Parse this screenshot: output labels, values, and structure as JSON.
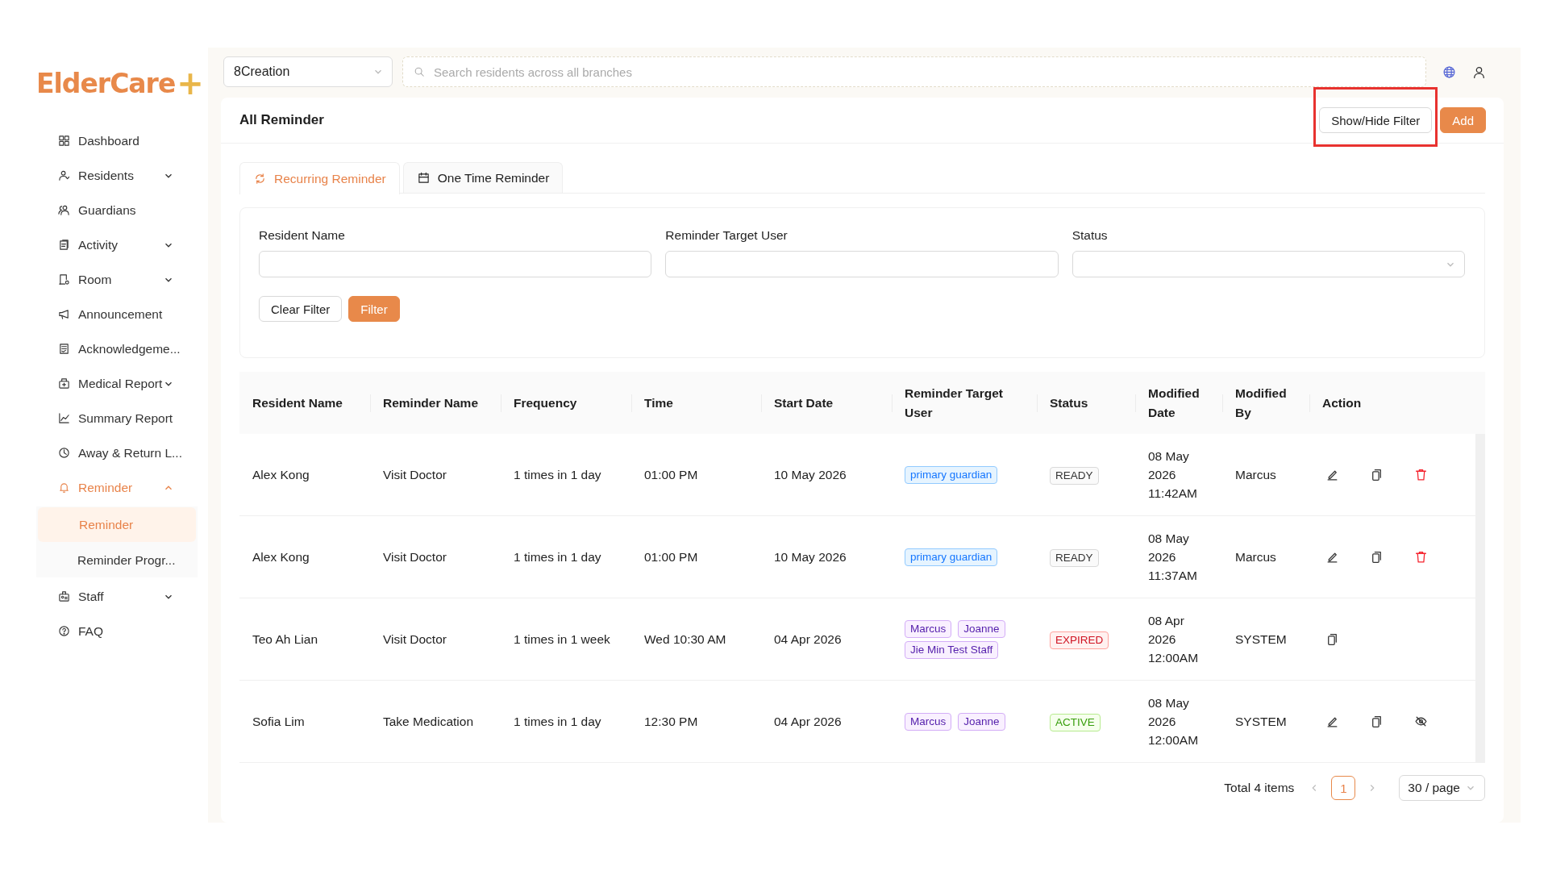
{
  "logo": {
    "text": "ElderCare",
    "mark": "+"
  },
  "sidebar": {
    "items": [
      {
        "label": "Dashboard",
        "kind": "link",
        "selected": false
      },
      {
        "label": "Residents",
        "kind": "group",
        "expanded": false,
        "selected": false
      },
      {
        "label": "Guardians",
        "kind": "link",
        "selected": false
      },
      {
        "label": "Activity",
        "kind": "group",
        "expanded": false,
        "selected": false
      },
      {
        "label": "Room",
        "kind": "group",
        "expanded": false,
        "selected": false
      },
      {
        "label": "Announcement",
        "kind": "link",
        "selected": false
      },
      {
        "label": "Acknowledgeme...",
        "kind": "link",
        "selected": false
      },
      {
        "label": "Medical Report",
        "kind": "group",
        "expanded": false,
        "selected": false
      },
      {
        "label": "Summary Report",
        "kind": "link",
        "selected": false
      },
      {
        "label": "Away & Return L...",
        "kind": "link",
        "selected": false
      },
      {
        "label": "Reminder",
        "kind": "group",
        "expanded": true,
        "selected": true,
        "children": [
          {
            "label": "Reminder",
            "selected": true
          },
          {
            "label": "Reminder Progr...",
            "selected": false
          }
        ]
      },
      {
        "label": "Staff",
        "kind": "group",
        "expanded": false,
        "selected": false
      },
      {
        "label": "FAQ",
        "kind": "link",
        "selected": false
      }
    ]
  },
  "topbar": {
    "branch": "8Creation",
    "search": {
      "placeholder": "Search residents across all branches"
    }
  },
  "page": {
    "title": "All Reminder",
    "buttons": [
      {
        "label": "Show/Hide Filter",
        "kind": "default",
        "highlighted": true
      },
      {
        "label": "Add",
        "kind": "primary",
        "highlighted": false
      }
    ]
  },
  "tabs": [
    {
      "label": "Recurring Reminder",
      "selected": true
    },
    {
      "label": "One Time Reminder",
      "selected": false
    }
  ],
  "filter": {
    "fields": [
      {
        "label": "Resident Name",
        "kind": "text"
      },
      {
        "label": "Reminder Target User",
        "kind": "text"
      },
      {
        "label": "Status",
        "kind": "select"
      }
    ],
    "buttons": [
      {
        "label": "Clear Filter",
        "kind": "default"
      },
      {
        "label": "Filter",
        "kind": "primary"
      }
    ]
  },
  "table": {
    "columns": [
      "Resident Name",
      "Reminder Name",
      "Frequency",
      "Time",
      "Start Date",
      "Reminder Target User",
      "Status",
      "Modified Date",
      "Modified By",
      "Action"
    ],
    "rows": [
      {
        "resident": "Alex Kong",
        "reminder": "Visit Doctor",
        "frequency": "1 times in 1 day",
        "time": "01:00 PM",
        "start": "10 May 2026",
        "targets": [
          {
            "text": "primary guardian",
            "kind": "role"
          }
        ],
        "status": {
          "text": "READY",
          "kind": "ready"
        },
        "modified_date": "08 May 2026 11:42AM",
        "modified_by": "Marcus",
        "actions": [
          {
            "kind": "edit"
          },
          {
            "kind": "copy"
          },
          {
            "kind": "delete"
          }
        ]
      },
      {
        "resident": "Alex Kong",
        "reminder": "Visit Doctor",
        "frequency": "1 times in 1 day",
        "time": "01:00 PM",
        "start": "10 May 2026",
        "targets": [
          {
            "text": "primary guardian",
            "kind": "role"
          }
        ],
        "status": {
          "text": "READY",
          "kind": "ready"
        },
        "modified_date": "08 May 2026 11:37AM",
        "modified_by": "Marcus",
        "actions": [
          {
            "kind": "edit"
          },
          {
            "kind": "copy"
          },
          {
            "kind": "delete"
          }
        ]
      },
      {
        "resident": "Teo Ah Lian",
        "reminder": "Visit Doctor",
        "frequency": "1 times in 1 week",
        "time": "Wed 10:30 AM",
        "start": "04 Apr 2026",
        "targets": [
          {
            "text": "Marcus",
            "kind": "user"
          },
          {
            "text": "Joanne",
            "kind": "user"
          },
          {
            "text": "Jie Min Test Staff",
            "kind": "user"
          }
        ],
        "status": {
          "text": "EXPIRED",
          "kind": "expired"
        },
        "modified_date": "08 Apr 2026 12:00AM",
        "modified_by": "SYSTEM",
        "actions": [
          {
            "kind": "copy"
          }
        ]
      },
      {
        "resident": "Sofia Lim",
        "reminder": "Take Medication",
        "frequency": "1 times in 1 day",
        "time": "12:30 PM",
        "start": "04 Apr 2026",
        "targets": [
          {
            "text": "Marcus",
            "kind": "user"
          },
          {
            "text": "Joanne",
            "kind": "user"
          }
        ],
        "status": {
          "text": "ACTIVE",
          "kind": "active"
        },
        "modified_date": "08 May 2026 12:00AM",
        "modified_by": "SYSTEM",
        "actions": [
          {
            "kind": "edit"
          },
          {
            "kind": "copy"
          },
          {
            "kind": "disable"
          }
        ]
      }
    ]
  },
  "pagination": {
    "total": "Total 4 items",
    "pages": [
      {
        "label": "1",
        "selected": true
      }
    ],
    "page_size": "30 / page"
  }
}
